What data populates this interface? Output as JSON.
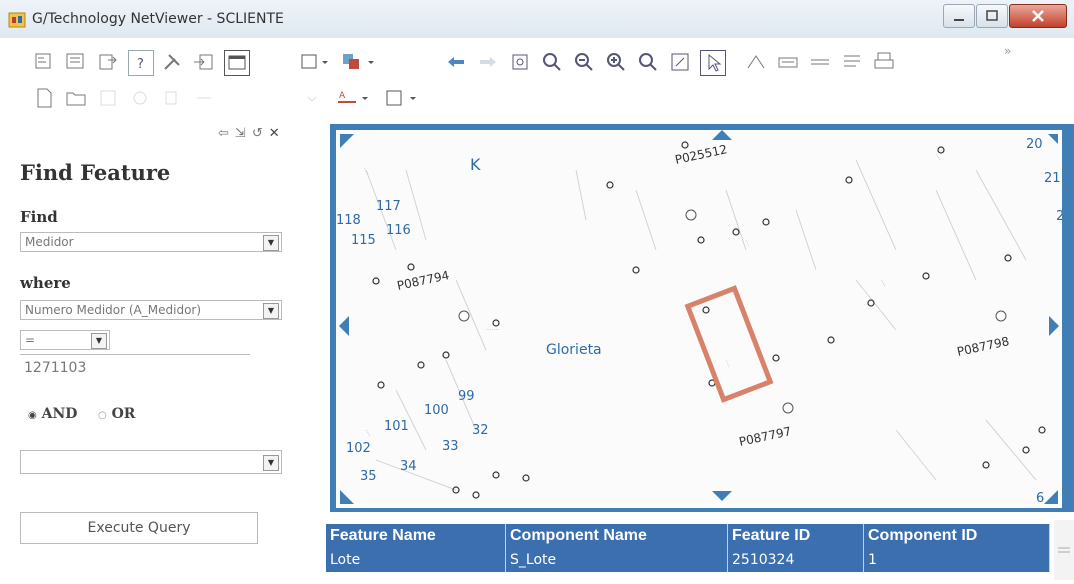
{
  "window": {
    "title": "G/Technology NetViewer - SCLIENTE",
    "toolbar_extra": "»"
  },
  "panel": {
    "title": "Find Feature",
    "find_label": "Find",
    "find_value": "Medidor",
    "where_label": "where",
    "where_value": "Numero Medidor (A_Medidor)",
    "operator_value": "=",
    "query_value": "1271103",
    "and_label": "AND",
    "or_label": "OR",
    "extra_value": "",
    "execute_label": "Execute Query"
  },
  "map": {
    "area_label": "Glorieta",
    "block_label": "K",
    "parcel_numbers": [
      "117",
      "116",
      "115",
      "118",
      "20",
      "21",
      "2",
      "100",
      "99",
      "101",
      "32",
      "33",
      "102",
      "34",
      "35",
      "6"
    ],
    "pole_labels": [
      "P025512",
      "P087794",
      "P087798",
      "P087797"
    ]
  },
  "results": {
    "columns": [
      "Feature Name",
      "Component Name",
      "Feature ID",
      "Component ID"
    ],
    "rows": [
      [
        "Lote",
        "S_Lote",
        "2510324",
        "1"
      ]
    ]
  },
  "colors": {
    "accent": "#3b6fb0",
    "selection": "#d9826a",
    "map_labels": "#2f6aa8"
  }
}
